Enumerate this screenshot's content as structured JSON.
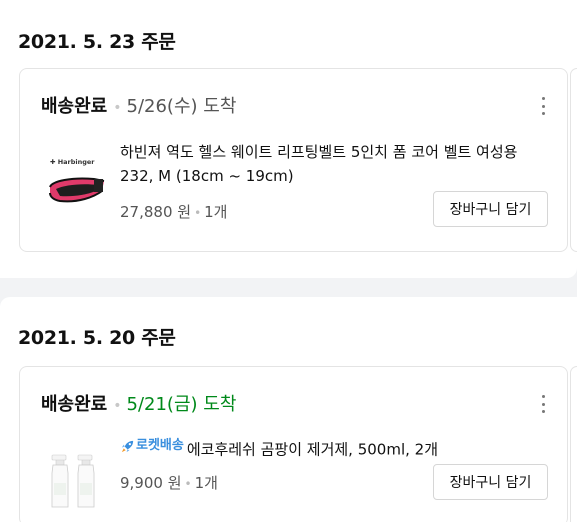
{
  "orders": [
    {
      "date": "2021. 5. 23 주문",
      "status": "배송완료",
      "separator": "•",
      "arrival": "5/26(수) 도착",
      "arrival_color": "#555555",
      "product": {
        "title": "하빈져 역도 헬스 웨이트 리프팅벨트 5인치 폼 코어 벨트 여성용 232, M (18cm ~ 19cm)",
        "price": "27,880 원",
        "qty": "1개",
        "image_icon": "weightlifting-belt-icon",
        "brand_on_image": "Harbinger"
      },
      "cart_button": "장바구니 담기"
    },
    {
      "date": "2021. 5. 20 주문",
      "status": "배송완료",
      "separator": "•",
      "arrival": "5/21(금) 도착",
      "arrival_color": "#00891a",
      "product": {
        "badge": "로켓배송",
        "badge_icon": "rocket-icon",
        "title": "에코후레쉬 곰팡이 제거제, 500ml, 2개",
        "price": "9,900 원",
        "qty": "1개",
        "image_icon": "spray-bottles-icon"
      },
      "cart_button": "장바구니 담기"
    }
  ]
}
